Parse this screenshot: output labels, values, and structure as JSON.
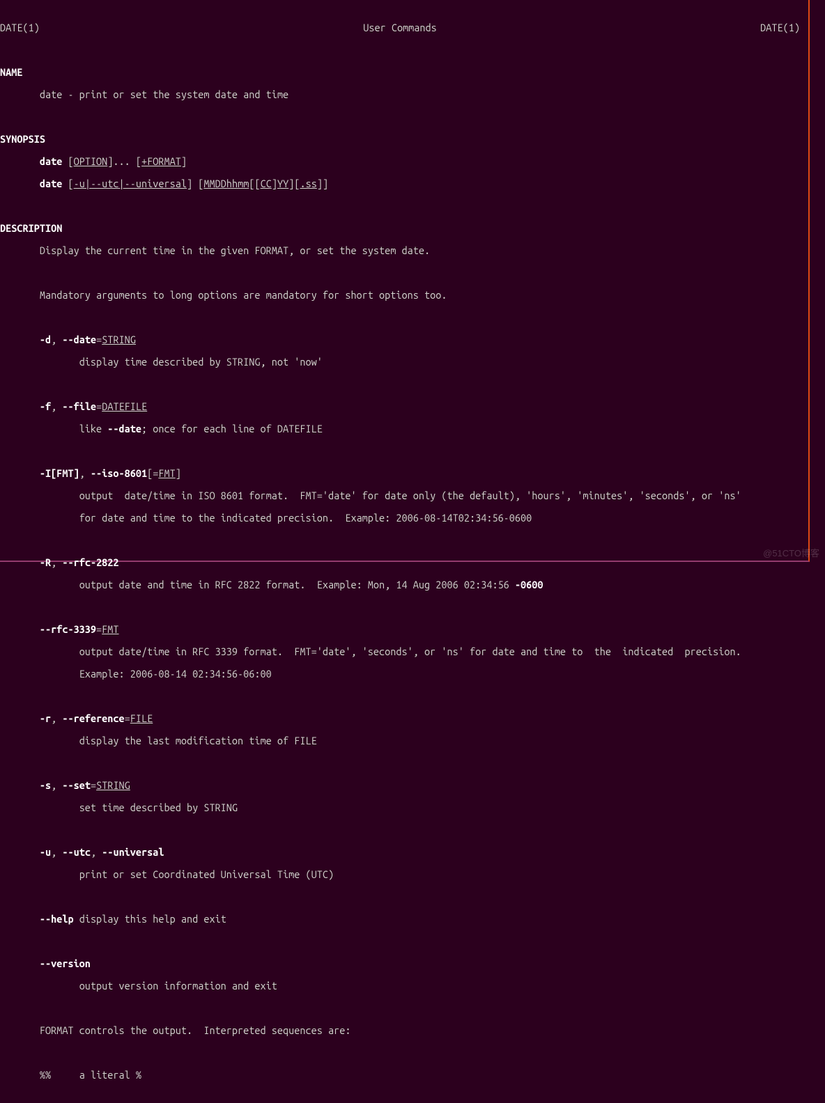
{
  "header": {
    "left": "DATE(1)",
    "center": "User Commands",
    "right": "DATE(1)"
  },
  "sections": {
    "name_label": "NAME",
    "name_text": "date - print or set the system date and time",
    "synopsis_label": "SYNOPSIS",
    "syn_cmd1": "date",
    "syn_opt1": "OPTION",
    "syn_dots": "]... [",
    "syn_fmt": "+FORMAT",
    "syn_close1": "]",
    "syn_cmd2": "date",
    "syn_open2": " [",
    "syn_u": "-u|--utc|--universal",
    "syn_mid2": "] [",
    "syn_mm": "MMDDhhmm",
    "syn_brk1": "[[",
    "syn_cc": "CC",
    "syn_brk2": "]",
    "syn_yy": "YY",
    "syn_brk3": "][",
    "syn_ss": ".ss",
    "syn_brk4": "]]",
    "desc_label": "DESCRIPTION",
    "desc1": "Display the current time in the given FORMAT, or set the system date.",
    "desc2": "Mandatory arguments to long options are mandatory for short options too.",
    "opt_d_flag": "-d",
    "opt_d_sep": ", ",
    "opt_d_long": "--date",
    "opt_d_eq": "=",
    "opt_d_arg": "STRING",
    "opt_d_desc": "display time described by STRING, not 'now'",
    "opt_f_flag": "-f",
    "opt_f_long": "--file",
    "opt_f_arg": "DATEFILE",
    "opt_f_desc_pre": "like ",
    "opt_f_desc_bold": "--date",
    "opt_f_desc_post": "; once for each line of DATEFILE",
    "opt_I_flag": "-I[FMT]",
    "opt_I_long": "--iso-8601",
    "opt_I_open": "[=",
    "opt_I_arg": "FMT",
    "opt_I_close": "]",
    "opt_I_desc1": "output  date/time in ISO 8601 format.  FMT='date' for date only (the default), 'hours', 'minutes', 'seconds', or 'ns'",
    "opt_I_desc2": "for date and time to the indicated precision.  Example: 2006-08-14T02:34:56-0600",
    "opt_R_flag": "-R",
    "opt_R_long": "--rfc-2822",
    "opt_R_desc_pre": "output date and time in RFC 2822 format.  Example: Mon, 14 Aug 2006 02:34:56 ",
    "opt_R_desc_bold": "-0600",
    "opt_3339_long": "--rfc-3339",
    "opt_3339_arg": "FMT",
    "opt_3339_desc1": "output date/time in RFC 3339 format.  FMT='date', 'seconds', or 'ns' for date and time to  the  indicated  precision.",
    "opt_3339_desc2": "Example: 2006-08-14 02:34:56-06:00",
    "opt_r_flag": "-r",
    "opt_r_long": "--reference",
    "opt_r_arg": "FILE",
    "opt_r_desc": "display the last modification time of FILE",
    "opt_s_flag": "-s",
    "opt_s_long": "--set",
    "opt_s_arg": "STRING",
    "opt_s_desc": "set time described by STRING",
    "opt_u_flag": "-u",
    "opt_u_long1": "--utc",
    "opt_u_long2": "--universal",
    "opt_u_desc": "print or set Coordinated Universal Time (UTC)",
    "opt_help_long": "--help",
    "opt_help_desc": " display this help and exit",
    "opt_ver_long": "--version",
    "opt_ver_desc": "output version information and exit",
    "fmt_intro": "FORMAT controls the output.  Interpreted sequences are:",
    "seq_pct": "%%",
    "seq_pct_desc": "a literal %"
  },
  "watermark": "@51CTO博客"
}
